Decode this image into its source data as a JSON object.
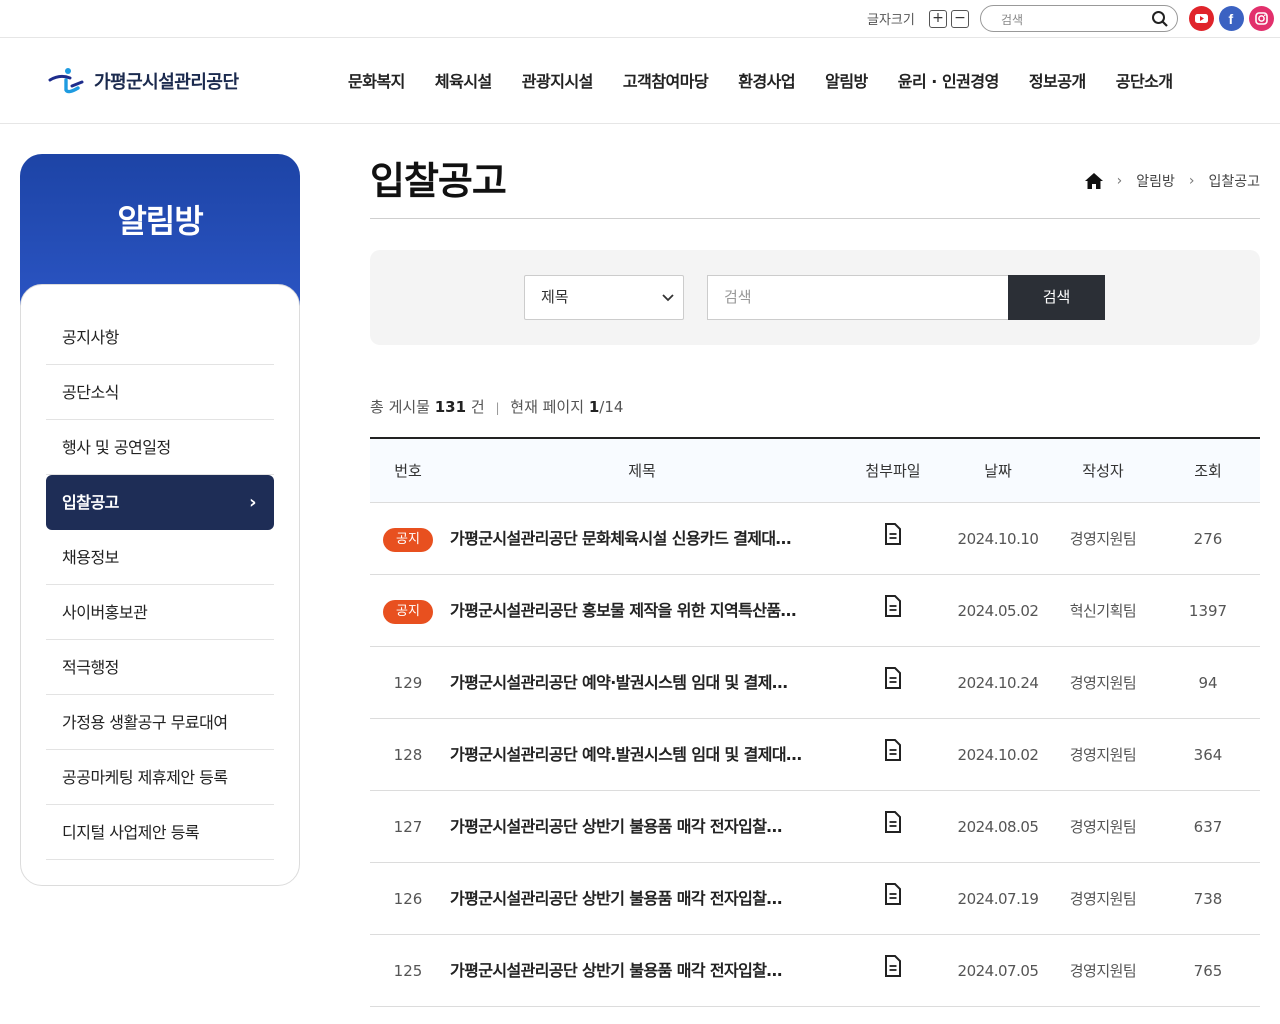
{
  "util": {
    "font_size_label": "글자크기",
    "plus": "+",
    "minus": "−",
    "search_placeholder": "검색",
    "sns": [
      {
        "name": "youtube",
        "color": "#e0242b"
      },
      {
        "name": "facebook",
        "color": "#3b62c2"
      },
      {
        "name": "instagram",
        "color": "#e2306c"
      }
    ]
  },
  "header": {
    "logo_text": "가평군시설관리공단",
    "menu": [
      "문화복지",
      "체육시설",
      "관광지시설",
      "고객참여마당",
      "환경사업",
      "알림방",
      "윤리 · 인권경영",
      "정보공개",
      "공단소개"
    ]
  },
  "sidebar": {
    "title": "알림방",
    "items": [
      {
        "label": "공지사항",
        "active": false
      },
      {
        "label": "공단소식",
        "active": false
      },
      {
        "label": "행사 및 공연일정",
        "active": false
      },
      {
        "label": "입찰공고",
        "active": true
      },
      {
        "label": "채용정보",
        "active": false
      },
      {
        "label": "사이버홍보관",
        "active": false
      },
      {
        "label": "적극행정",
        "active": false
      },
      {
        "label": "가정용 생활공구 무료대여",
        "active": false
      },
      {
        "label": "공공마케팅 제휴제안 등록",
        "active": false
      },
      {
        "label": "디지털 사업제안 등록",
        "active": false
      }
    ]
  },
  "page": {
    "title": "입찰공고",
    "breadcrumb": [
      "알림방",
      "입찰공고"
    ]
  },
  "search": {
    "select_value": "제목",
    "input_placeholder": "검색",
    "button_label": "검색"
  },
  "summary": {
    "total_prefix": "총 게시물",
    "total": "131",
    "total_unit": "건",
    "page_prefix": "현재 페이지",
    "current_page": "1",
    "total_pages": "/14"
  },
  "table": {
    "headers": [
      "번호",
      "제목",
      "첨부파일",
      "날짜",
      "작성자",
      "조회"
    ],
    "rows": [
      {
        "num": "공지",
        "notice": true,
        "title": "가평군시설관리공단 문화체육시설 신용카드 결제대…",
        "date": "2024.10.10",
        "writer": "경영지원팀",
        "views": "276"
      },
      {
        "num": "공지",
        "notice": true,
        "title": "가평군시설관리공단 홍보물 제작을 위한 지역특산품…",
        "date": "2024.05.02",
        "writer": "혁신기획팀",
        "views": "1397"
      },
      {
        "num": "129",
        "notice": false,
        "title": "가평군시설관리공단 예약·발권시스템 임대 및 결제…",
        "date": "2024.10.24",
        "writer": "경영지원팀",
        "views": "94"
      },
      {
        "num": "128",
        "notice": false,
        "title": "가평군시설관리공단 예약.발권시스템 임대 및 결제대…",
        "date": "2024.10.02",
        "writer": "경영지원팀",
        "views": "364"
      },
      {
        "num": "127",
        "notice": false,
        "title": "가평군시설관리공단 상반기 불용품 매각 전자입찰…",
        "date": "2024.08.05",
        "writer": "경영지원팀",
        "views": "637"
      },
      {
        "num": "126",
        "notice": false,
        "title": "가평군시설관리공단 상반기 불용품 매각 전자입찰…",
        "date": "2024.07.19",
        "writer": "경영지원팀",
        "views": "738"
      },
      {
        "num": "125",
        "notice": false,
        "title": "가평군시설관리공단 상반기 불용품 매각 전자입찰…",
        "date": "2024.07.05",
        "writer": "경영지원팀",
        "views": "765"
      }
    ]
  }
}
